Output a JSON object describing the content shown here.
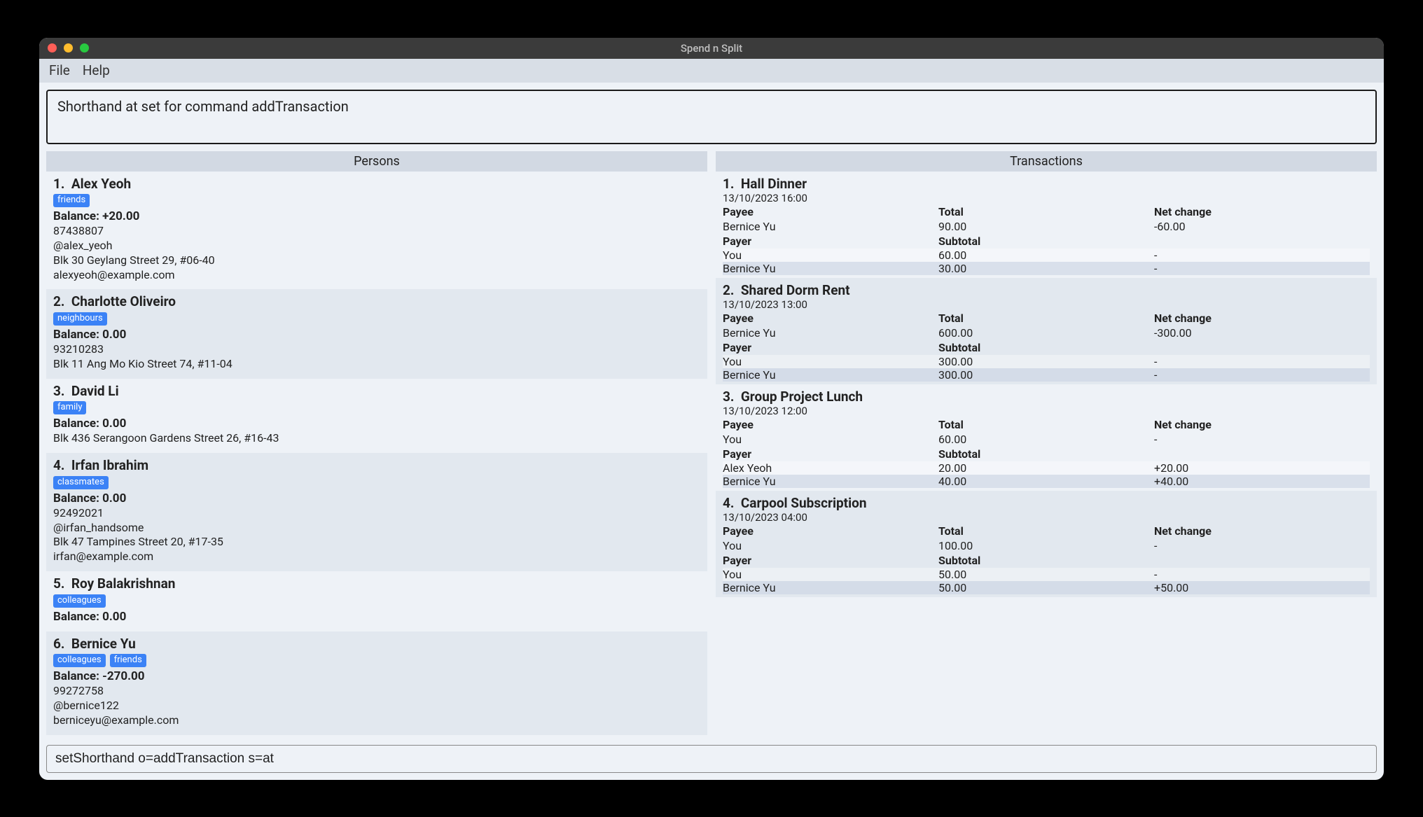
{
  "window": {
    "title": "Spend n Split"
  },
  "menubar": {
    "file": "File",
    "help": "Help"
  },
  "output": "Shorthand at set for command addTransaction",
  "persons_header": "Persons",
  "transactions_header": "Transactions",
  "persons": [
    {
      "index": "1.",
      "name": "Alex Yeoh",
      "tags": [
        "friends"
      ],
      "balance": "Balance: +20.00",
      "phone": "87438807",
      "handle": "@alex_yeoh",
      "address": "Blk 30 Geylang Street 29, #06-40",
      "email": "alexyeoh@example.com"
    },
    {
      "index": "2.",
      "name": "Charlotte Oliveiro",
      "tags": [
        "neighbours"
      ],
      "balance": "Balance: 0.00",
      "phone": "93210283",
      "address": "Blk 11 Ang Mo Kio Street 74, #11-04"
    },
    {
      "index": "3.",
      "name": "David Li",
      "tags": [
        "family"
      ],
      "balance": "Balance: 0.00",
      "address": "Blk 436 Serangoon Gardens Street 26, #16-43"
    },
    {
      "index": "4.",
      "name": "Irfan Ibrahim",
      "tags": [
        "classmates"
      ],
      "balance": "Balance: 0.00",
      "phone": "92492021",
      "handle": "@irfan_handsome",
      "address": "Blk 47 Tampines Street 20, #17-35",
      "email": "irfan@example.com"
    },
    {
      "index": "5.",
      "name": "Roy Balakrishnan",
      "tags": [
        "colleagues"
      ],
      "balance": "Balance: 0.00"
    },
    {
      "index": "6.",
      "name": "Bernice Yu",
      "tags": [
        "colleagues",
        "friends"
      ],
      "balance": "Balance: -270.00",
      "phone": "99272758",
      "handle": "@bernice122",
      "email": "berniceyu@example.com"
    }
  ],
  "labels": {
    "payee": "Payee",
    "total": "Total",
    "net_change": "Net change",
    "payer": "Payer",
    "subtotal": "Subtotal"
  },
  "transactions": [
    {
      "index": "1.",
      "name": "Hall Dinner",
      "date": "13/10/2023 16:00",
      "payee": {
        "name": "Bernice Yu",
        "total": "90.00",
        "net": "-60.00"
      },
      "payers": [
        {
          "name": "You",
          "subtotal": "60.00",
          "net": "-"
        },
        {
          "name": "Bernice Yu",
          "subtotal": "30.00",
          "net": "-"
        }
      ]
    },
    {
      "index": "2.",
      "name": "Shared Dorm Rent",
      "date": "13/10/2023 13:00",
      "payee": {
        "name": "Bernice Yu",
        "total": "600.00",
        "net": "-300.00"
      },
      "payers": [
        {
          "name": "You",
          "subtotal": "300.00",
          "net": "-"
        },
        {
          "name": "Bernice Yu",
          "subtotal": "300.00",
          "net": "-"
        }
      ]
    },
    {
      "index": "3.",
      "name": "Group Project Lunch",
      "date": "13/10/2023 12:00",
      "payee": {
        "name": "You",
        "total": "60.00",
        "net": "-"
      },
      "payers": [
        {
          "name": "Alex Yeoh",
          "subtotal": "20.00",
          "net": "+20.00"
        },
        {
          "name": "Bernice Yu",
          "subtotal": "40.00",
          "net": "+40.00"
        }
      ]
    },
    {
      "index": "4.",
      "name": "Carpool Subscription",
      "date": "13/10/2023 04:00",
      "payee": {
        "name": "You",
        "total": "100.00",
        "net": "-"
      },
      "payers": [
        {
          "name": "You",
          "subtotal": "50.00",
          "net": "-"
        },
        {
          "name": "Bernice Yu",
          "subtotal": "50.00",
          "net": "+50.00"
        }
      ]
    }
  ],
  "command_input": "setShorthand o=addTransaction s=at"
}
